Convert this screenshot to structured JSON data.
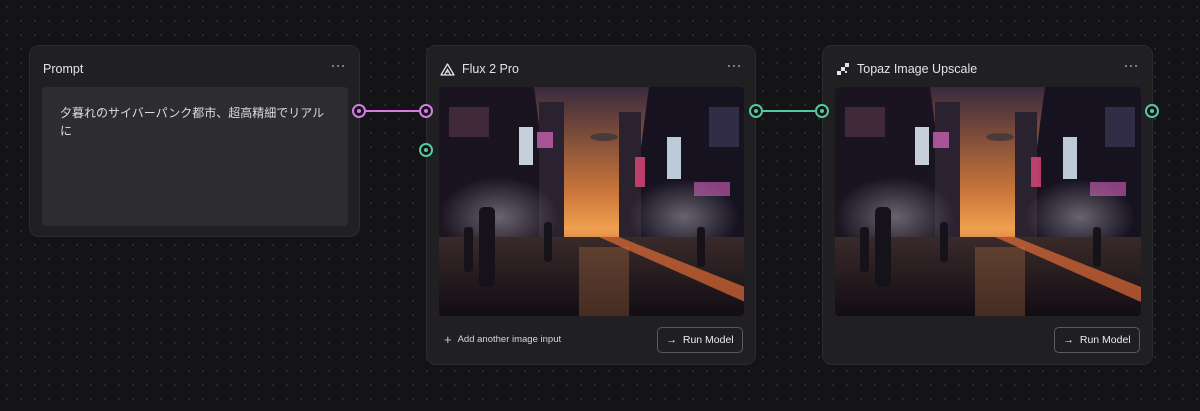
{
  "prompt_node": {
    "title": "Prompt",
    "text": "夕暮れのサイバーパンク都市、超高精細でリアルに"
  },
  "flux_node": {
    "title": "Flux 2 Pro",
    "add_input_label": "Add another image input",
    "run_label": "Run Model"
  },
  "topaz_node": {
    "title": "Topaz Image Upscale",
    "run_label": "Run Model"
  },
  "icons": {
    "flux": "flux-triangle-icon",
    "topaz": "topaz-pixel-icon",
    "menu": "more-dots-icon",
    "arrow": "arrow-right-icon",
    "plus": "plus-icon"
  },
  "colors": {
    "text_edge": "#d77be5",
    "image_edge": "#56c8a0",
    "background": "#141416",
    "node": "#202023"
  }
}
